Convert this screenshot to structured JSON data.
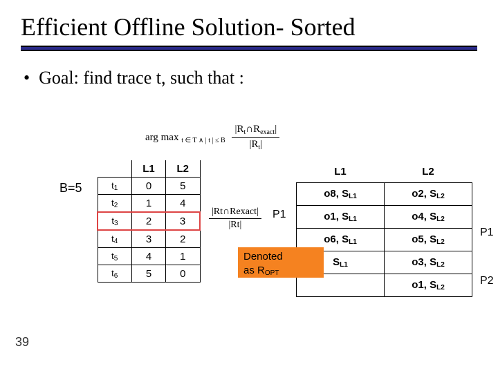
{
  "page_number": "39",
  "title": "Efficient Offline Solution- Sorted",
  "goal_bullet": "•",
  "goal_text": "Goal: find trace t, such that :",
  "formula": {
    "argmax": "arg max",
    "argmax_sub": "t ∈ T ∧ | t | ≤ B",
    "num": "|R",
    "num_t": "t",
    "num_cap": "∩R",
    "num_exact": "exact",
    "num_end": "|",
    "den": "|R",
    "den_t": "t",
    "den_end": "|"
  },
  "b_label": "B=5",
  "trace_headers": {
    "c0": "",
    "c1": "L1",
    "c2": "L2"
  },
  "trace_rows": [
    {
      "t": "t",
      "ti": "1",
      "l1": "0",
      "l2": "5"
    },
    {
      "t": "t",
      "ti": "2",
      "l1": "1",
      "l2": "4"
    },
    {
      "t": "t",
      "ti": "3",
      "l1": "2",
      "l2": "3"
    },
    {
      "t": "t",
      "ti": "4",
      "l1": "3",
      "l2": "2"
    },
    {
      "t": "t",
      "ti": "5",
      "l1": "4",
      "l2": "1"
    },
    {
      "t": "t",
      "ti": "6",
      "l1": "5",
      "l2": "0"
    }
  ],
  "mid_formula": {
    "num": "|R",
    "num_t": "t",
    "num_cap": "∩R",
    "num_exact": "exact",
    "num_end": "|",
    "den": "|R",
    "den_t": "t",
    "den_end": "|"
  },
  "p_labels": {
    "p1": "P1",
    "p1r": "P1",
    "p2r": "P2"
  },
  "result_headers": {
    "c1": "L1",
    "c2": "L2"
  },
  "result_rows": [
    {
      "o1": "o8, S",
      "s1": "L1",
      "o2": "o2, S",
      "s2": "L2"
    },
    {
      "o1": "o1, S",
      "s1": "L1",
      "o2": "o4, S",
      "s2": "L2"
    },
    {
      "o1": "o6, S",
      "s1": "L1",
      "o2": "o5, S",
      "s2": "L2"
    },
    {
      "o1": "S",
      "s1": "L1",
      "o2": "o3, S",
      "s2": "L2"
    },
    {
      "o1": "",
      "s1": "",
      "o2": "o1, S",
      "s2": "L2"
    }
  ],
  "denoted": {
    "line1": "Denoted",
    "line2a": "as R",
    "line2b": "OPT"
  }
}
